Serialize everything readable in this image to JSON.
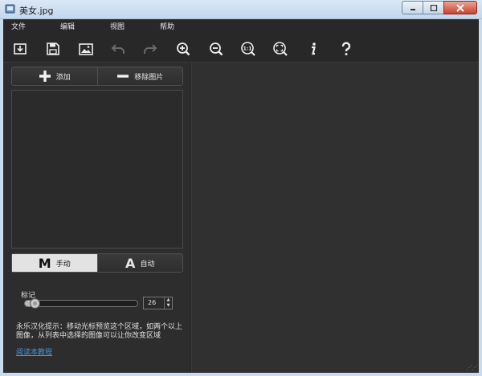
{
  "window": {
    "title": "美女.jpg",
    "icons": {
      "app": "app-icon",
      "minimize": "minimize-icon",
      "maximize": "maximize-icon",
      "close": "close-icon"
    }
  },
  "menu": {
    "items": [
      "文件",
      "编辑",
      "视图",
      "帮助"
    ]
  },
  "toolbar": {
    "icons": [
      "open-icon",
      "save-icon",
      "image-icon",
      "undo-icon",
      "redo-icon",
      "zoom-in-icon",
      "zoom-out-icon",
      "zoom-actual-size-icon",
      "zoom-fit-icon",
      "info-icon",
      "help-icon"
    ]
  },
  "left_panel": {
    "add_label": "添加",
    "remove_label": "移除图片",
    "mode": {
      "manual_letter": "M",
      "manual_label": "手动",
      "auto_letter": "A",
      "auto_label": "自动",
      "active": "manual"
    },
    "mark": {
      "label": "标记",
      "value": "26",
      "slider_fraction": 0.04
    },
    "hint": "永乐汉化提示：移动光标预览这个区域，如两个以上图像，从列表中选择的图像可以让你改变区域",
    "link": "阅读本教程"
  },
  "colors": {
    "background": "#282828",
    "panel": "#2d2d2d",
    "active_toggle": "#e3e3e3",
    "link": "#4a90d9"
  }
}
